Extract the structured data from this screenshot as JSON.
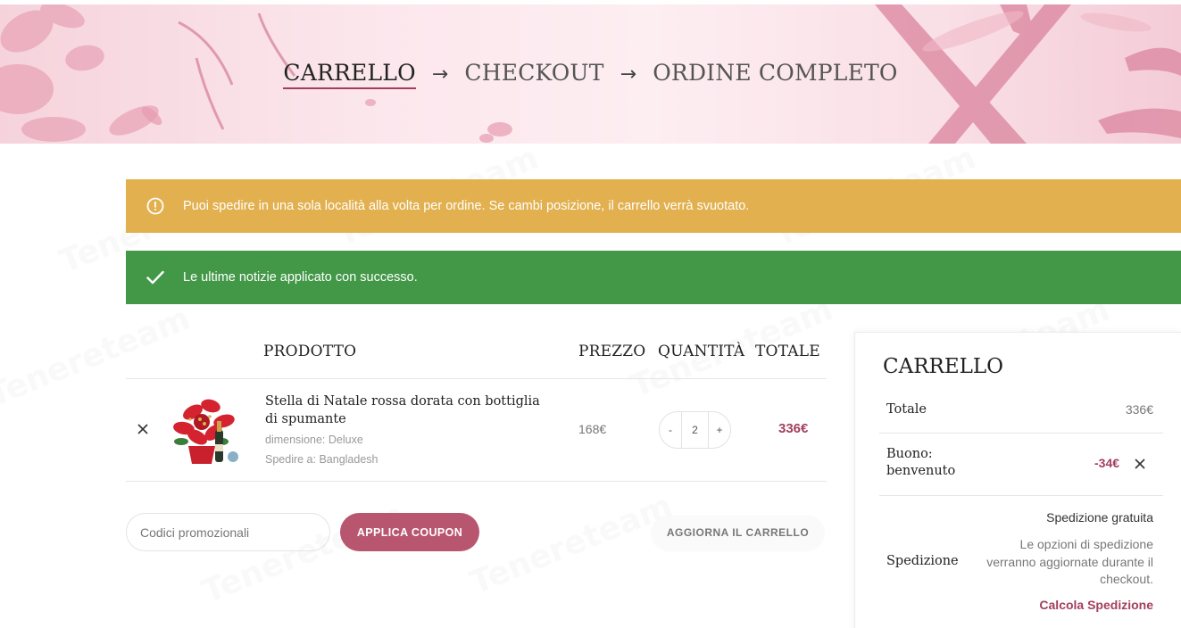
{
  "steps": {
    "cart": "CARRELLO",
    "arrow": "→",
    "checkout": "CHECKOUT",
    "complete": "ORDINE COMPLETO"
  },
  "notices": {
    "warning": "Puoi spedire in una sola località alla volta per ordine. Se cambi posizione, il carrello verrà svuotato.",
    "success": "Le ultime notizie applicato con successo."
  },
  "table": {
    "headers": {
      "product": "PRODOTTO",
      "price": "PREZZO",
      "quantity": "QUANTITÀ",
      "total": "TOTALE"
    },
    "item": {
      "name": "Stella di Natale rossa dorata con bottiglia di spumante",
      "size": "dimensione: Deluxe",
      "ship_to": "Spedire a: Bangladesh",
      "price": "168€",
      "qty_minus": "-",
      "qty": "2",
      "qty_plus": "+",
      "line_total": "336€"
    }
  },
  "coupon": {
    "placeholder": "Codici promozionali",
    "apply": "APPLICA COUPON",
    "update": "AGGIORNA IL CARRELLO"
  },
  "totals": {
    "title": "CARRELLO",
    "subtotal_label": "Totale",
    "subtotal_value": "336€",
    "coupon_label_1": "Buono:",
    "coupon_label_2": "benvenuto",
    "coupon_value": "-34€",
    "shipping_label": "Spedizione",
    "shipping_free": "Spedizione gratuita",
    "shipping_note": "Le opzioni di spedizione verranno aggiornate durante il checkout.",
    "calc_shipping": "Calcola Spedizione"
  },
  "colors": {
    "accent": "#a33f5d",
    "button": "#b9566f",
    "warning": "#e2b04f",
    "success": "#439848"
  },
  "watermark": "Tenereteam"
}
